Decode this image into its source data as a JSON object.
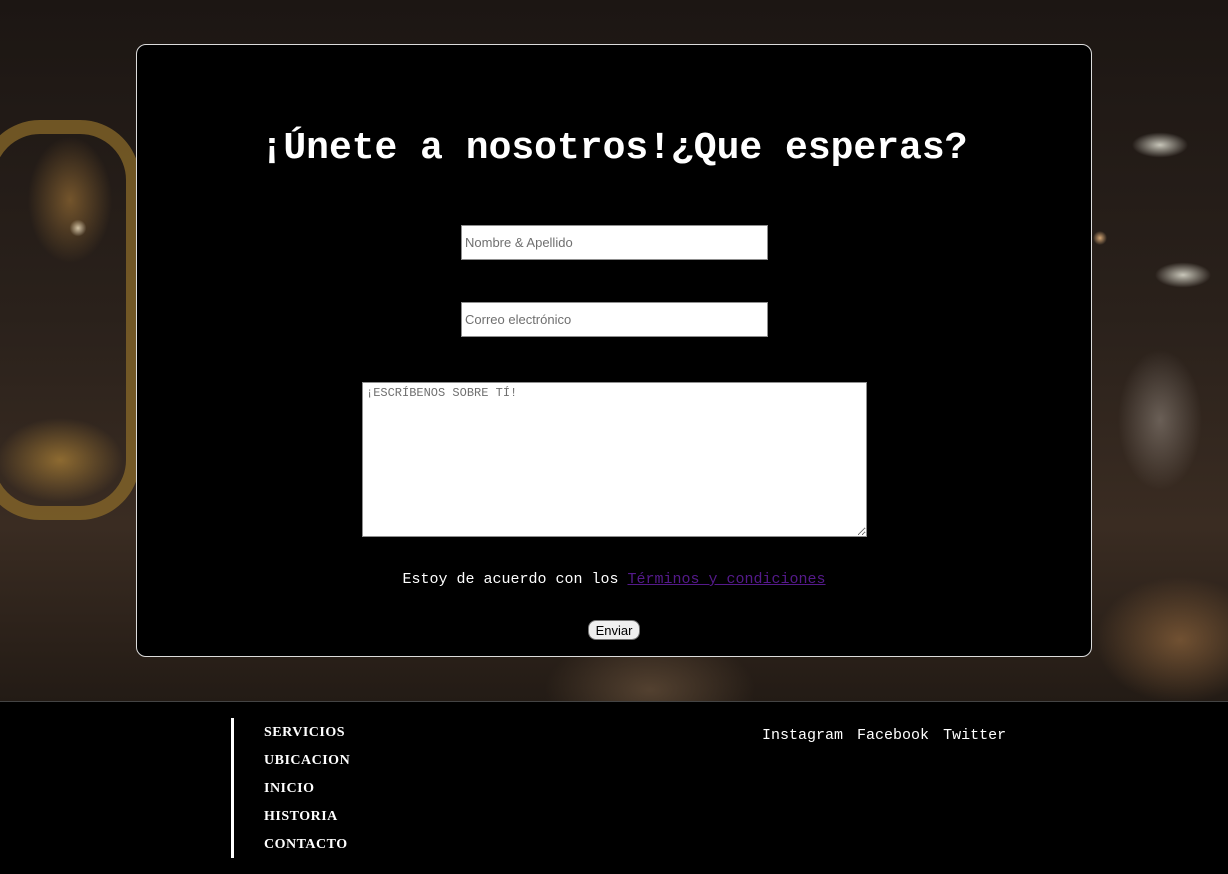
{
  "form": {
    "heading": "¡Únete a nosotros!¿Que esperas?",
    "name_placeholder": "Nombre & Apellido",
    "email_placeholder": "Correo electrónico",
    "about_placeholder": "¡ESCRÍBENOS SOBRE TÍ!",
    "terms_text": "Estoy de acuerdo con los",
    "terms_link": "Términos y condiciones",
    "submit_label": "Enviar"
  },
  "footer": {
    "nav": [
      "SERVICIOS",
      "UBICACION",
      "INICIO",
      "HISTORIA",
      "CONTACTO"
    ],
    "social": [
      "Instagram",
      "Facebook",
      "Twitter"
    ]
  },
  "colors": {
    "card_background": "#000000",
    "card_border": "#dcdcdc",
    "link_visited": "#551a8b",
    "footer_background": "#000000"
  }
}
